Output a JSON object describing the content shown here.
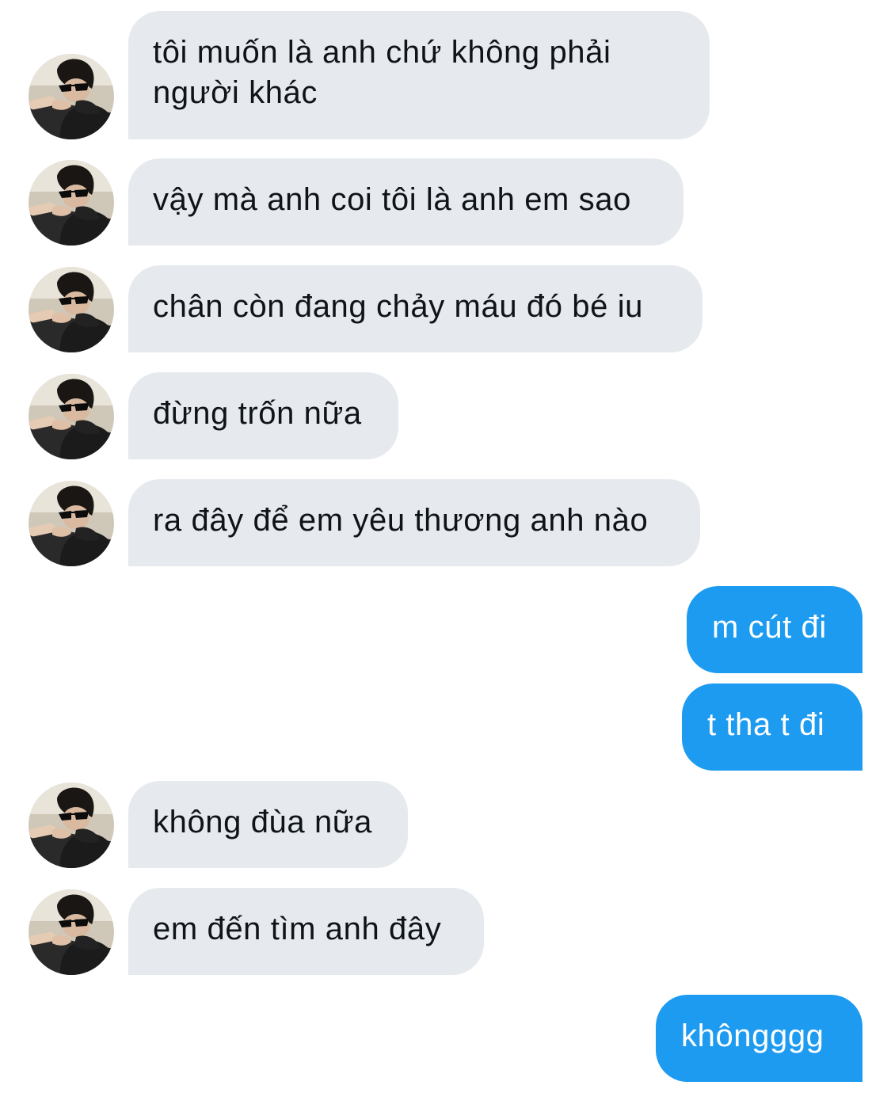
{
  "conversation": {
    "messages": [
      {
        "direction": "incoming",
        "lines": [
          "tôi muốn là anh chứ không phải",
          "người khác"
        ]
      },
      {
        "direction": "incoming",
        "text": "vậy mà anh coi tôi là anh em sao"
      },
      {
        "direction": "incoming",
        "text": "chân còn đang chảy máu đó bé iu"
      },
      {
        "direction": "incoming",
        "text": "đừng trốn nữa"
      },
      {
        "direction": "incoming",
        "text": "ra đây để em yêu thương anh nào"
      },
      {
        "direction": "outgoing",
        "text": "m cút đi"
      },
      {
        "direction": "outgoing",
        "text": "t tha t đi"
      },
      {
        "direction": "incoming",
        "text": "không đùa nữa"
      },
      {
        "direction": "incoming",
        "text": "em đến tìm anh đây"
      },
      {
        "direction": "outgoing",
        "text": "khôngggg"
      }
    ]
  },
  "theme": {
    "incoming_bubble_color": "#e6eaee",
    "incoming_text_color": "#0f1419",
    "outgoing_bubble_color": "#1d9bf0",
    "outgoing_text_color": "#ffffff"
  },
  "avatar": {
    "icon": "contact-avatar-photo"
  }
}
